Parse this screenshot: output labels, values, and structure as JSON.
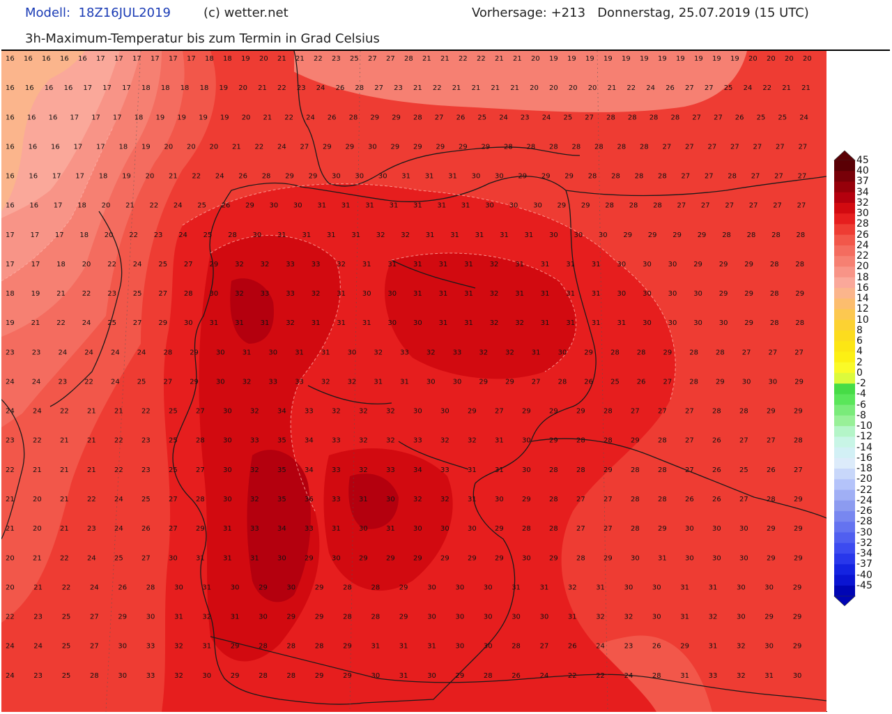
{
  "header": {
    "model": "Modell:  18Z16JUL2019",
    "copyright": "(c) wetter.net",
    "forecast": "Vorhersage: +213   Donnerstag, 25.07.2019 (15 UTC)",
    "subtitle": "3h-Maximum-Temperatur bis zum Termin in Grad Celsius"
  },
  "legend": {
    "unit": "°C",
    "levels": [
      {
        "label": "45",
        "color": "#5a0005"
      },
      {
        "label": "40",
        "color": "#780008"
      },
      {
        "label": "37",
        "color": "#96000a"
      },
      {
        "label": "34",
        "color": "#b4000e"
      },
      {
        "label": "32",
        "color": "#d20a10"
      },
      {
        "label": "30",
        "color": "#e61e1e"
      },
      {
        "label": "28",
        "color": "#ee3c33"
      },
      {
        "label": "26",
        "color": "#f2574a"
      },
      {
        "label": "24",
        "color": "#f46c5f"
      },
      {
        "label": "22",
        "color": "#f68072"
      },
      {
        "label": "20",
        "color": "#f89487"
      },
      {
        "label": "18",
        "color": "#faa89a"
      },
      {
        "label": "16",
        "color": "#fbb58c"
      },
      {
        "label": "14",
        "color": "#fcbd6e"
      },
      {
        "label": "12",
        "color": "#fcc850"
      },
      {
        "label": "10",
        "color": "#fcd232"
      },
      {
        "label": "8",
        "color": "#fcdc1e"
      },
      {
        "label": "6",
        "color": "#fce614"
      },
      {
        "label": "4",
        "color": "#fcf014"
      },
      {
        "label": "2",
        "color": "#fafa28"
      },
      {
        "label": "0",
        "color": "#dcfa3c"
      },
      {
        "label": "-2",
        "color": "#46dc46"
      },
      {
        "label": "-4",
        "color": "#5ae65a"
      },
      {
        "label": "-6",
        "color": "#7aeb7a"
      },
      {
        "label": "-8",
        "color": "#98f098"
      },
      {
        "label": "-10",
        "color": "#b4f5c8"
      },
      {
        "label": "-12",
        "color": "#c8f5e6"
      },
      {
        "label": "-14",
        "color": "#d2f0f5"
      },
      {
        "label": "-16",
        "color": "#dcebfa"
      },
      {
        "label": "-18",
        "color": "#c8d7fa"
      },
      {
        "label": "-20",
        "color": "#b4c3fa"
      },
      {
        "label": "-22",
        "color": "#a0aff5"
      },
      {
        "label": "-24",
        "color": "#8c9bf0"
      },
      {
        "label": "-26",
        "color": "#7887f0"
      },
      {
        "label": "-28",
        "color": "#6473f0"
      },
      {
        "label": "-30",
        "color": "#505ff0"
      },
      {
        "label": "-32",
        "color": "#3c4bf0"
      },
      {
        "label": "-34",
        "color": "#2837eb"
      },
      {
        "label": "-37",
        "color": "#1423e1"
      },
      {
        "label": "-40",
        "color": "#0a14d2"
      },
      {
        "label": "-45",
        "color": "#0005b4"
      }
    ]
  },
  "map": {
    "background": "#ee3c33",
    "region_colors": {
      "t16": "#fbb58c",
      "t18": "#faa89a",
      "t20": "#f89487",
      "t22": "#f68072",
      "t24": "#f46c5f",
      "t26": "#f2574a",
      "t28": "#ee3c33",
      "t30": "#e61e1e",
      "t32": "#d20a10",
      "t34": "#b4000e"
    },
    "value_rows": [
      "16 16 16 16 16 17 17 17 17 17 17 18 18 19 20 21 21 22 23 25 27 27 28 21 21 22 22 21 21 20 19 19 19 19 19 19 19 19 19 19 19 20 20 20 20",
      "16 16 16 16 17 17 17 18 18 18 18 19 20 21 22 23 24 26 28 27 23 21 22 21 21 21 21 20 20 20 20 21 22 24 26 27 27 25 24 22 21 21",
      "16 16 16 17 17 17 18 19 19 19 19 20 21 22 24 26 28 29 29 28 27 26 25 24 23 24 25 27 28 28 28 28 27 27 26 25 25 24",
      "16 16 16 17 17 18 19 20 20 20 21 22 24 27 29 29 30 29 29 29 29 29 28 28 28 28 28 28 28 27 27 27 27 27 27 27",
      "16 16 17 17 18 19 20 21 22 24 26 28 29 29 30 30 30 31 31 31 30 30 29 29 29 28 28 28 28 27 27 28 27 27 27",
      "16 16 17 18 20 21 22 24 25 26 29 30 30 31 31 31 31 31 31 31 30 30 30 29 29 28 28 28 27 27 27 27 27 27",
      "17 17 17 18 20 22 23 24 25 28 30 31 31 31 31 32 32 31 31 31 31 31 30 30 30 29 29 29 29 28 28 28 28",
      "17 17 18 20 22 24 25 27 29 32 32 33 33 32 31 31 31 31 31 32 31 31 31 31 30 30 30 29 29 29 28 28",
      "18 19 21 22 23 25 27 28 30 32 33 33 32 31 30 30 31 31 31 32 31 31 31 31 30 30 30 30 29 29 28 29",
      "19 21 22 24 25 27 29 30 31 31 31 32 31 31 31 30 30 31 31 32 32 31 31 31 31 30 30 30 30 29 28 28",
      "23 23 24 24 24 24 28 29 30 31 30 31 31 30 32 33 32 33 32 32 31 30 29 28 28 29 28 28 27 27 27",
      "24 24 23 22 24 25 27 29 30 32 33 33 32 32 31 31 30 30 29 29 27 28 26 25 26 27 28 29 30 30 29",
      "24 24 22 21 21 22 25 27 30 32 34 33 32 32 32 30 30 29 27 29 29 29 28 27 27 27 28 28 29 29",
      "23 22 21 21 22 23 25 28 30 33 35 34 33 32 32 33 32 32 31 30 29 28 28 29 28 27 26 27 27 28",
      "22 21 21 21 22 23 25 27 30 32 35 34 33 32 33 34 33 31 31 30 28 28 29 28 28 27 26 25 26 27",
      "21 20 21 22 24 25 27 28 30 32 35 36 33 31 30 32 32 31 30 29 28 27 27 28 28 26 26 27 28 29",
      "21 20 21 23 24 26 27 29 31 33 34 33 31 30 31 30 30 30 29 28 28 27 27 28 29 30 30 30 29 29",
      "20 21 22 24 25 27 30 31 31 31 30 29 30 29 29 29 29 29 29 30 29 28 29 30 31 30 30 30 29 29",
      "20 21 22 24 26 28 30 31 30 29 30 29 28 28 29 30 30 30 31 31 32 31 30 30 31 31 30 30 29",
      "22 23 25 27 29 30 31 32 31 30 29 29 28 28 29 30 30 30 30 30 31 32 32 30 31 32 30 29 29",
      "24 24 25 27 30 33 32 31 29 28 28 28 29 31 31 31 30 30 28 27 26 24 23 26 29 31 32 30 29",
      "24 23 25 28 30 33 32 30 29 28 28 29 29 30 31 30 29 28 26 24 22 22 24 28 31 33 32 31 30"
    ]
  }
}
